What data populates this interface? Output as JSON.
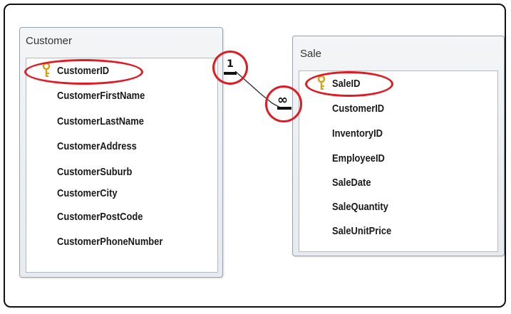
{
  "customer_table": {
    "title": "Customer",
    "primary_key": "CustomerID",
    "fields": [
      "CustomerFirstName",
      "CustomerLastName",
      "CustomerAddress",
      "CustomerSuburb",
      "CustomerCity",
      "CustomerPostCode",
      "CustomerPhoneNumber"
    ]
  },
  "sale_table": {
    "title": "Sale",
    "primary_key": "SaleID",
    "fields": [
      "CustomerID",
      "InventoryID",
      "EmployeeID",
      "SaleDate",
      "SaleQuantity",
      "SaleUnitPrice"
    ]
  },
  "relationship": {
    "one_side_label": "1",
    "many_side_label": "∞"
  },
  "colors": {
    "highlight": "#e01a22",
    "key": "#d4a21a"
  },
  "icons": {
    "primary_key": "key-icon"
  }
}
